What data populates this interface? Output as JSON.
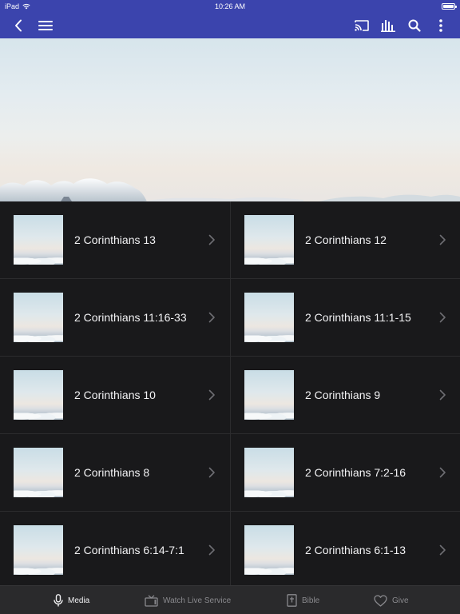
{
  "status_bar": {
    "device": "iPad",
    "time": "10:26 AM"
  },
  "app_bar": {
    "back_icon": "chevron-left-icon",
    "menu_icon": "hamburger-menu-icon",
    "cast_icon": "cast-icon",
    "audio_icon": "audio-bars-icon",
    "search_icon": "search-icon",
    "more_icon": "more-vertical-icon"
  },
  "sermons": [
    {
      "title": "2 Corinthians 13"
    },
    {
      "title": "2 Corinthians 12"
    },
    {
      "title": "2 Corinthians 11:16-33"
    },
    {
      "title": "2 Corinthians 11:1-15"
    },
    {
      "title": "2 Corinthians 10"
    },
    {
      "title": "2 Corinthians 9"
    },
    {
      "title": "2 Corinthians 8"
    },
    {
      "title": "2 Corinthians 7:2-16"
    },
    {
      "title": "2 Corinthians 6:14-7:1"
    },
    {
      "title": "2 Corinthians 6:1-13"
    }
  ],
  "tab_bar": {
    "tabs": [
      {
        "label": "Media",
        "icon": "microphone-icon",
        "active": true
      },
      {
        "label": "Watch Live Service",
        "icon": "tv-icon",
        "active": false
      },
      {
        "label": "Bible",
        "icon": "bible-icon",
        "active": false
      },
      {
        "label": "Give",
        "icon": "heart-icon",
        "active": false
      }
    ]
  },
  "colors": {
    "app_bar": "#3b44ad",
    "background": "#19191b",
    "tab_bar": "#2a2a2c",
    "active_tab": "#f0f0f2",
    "inactive_tab": "#8a8a8e"
  }
}
